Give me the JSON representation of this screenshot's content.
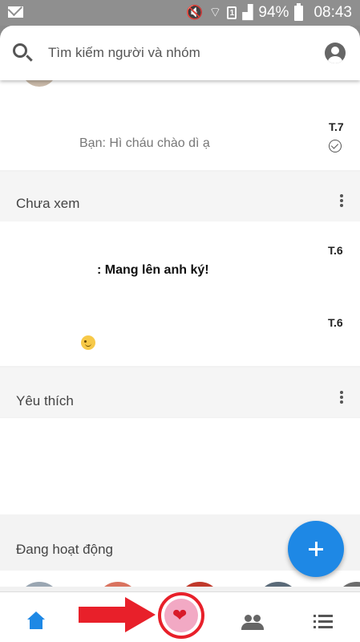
{
  "status_bar": {
    "battery": "94%",
    "time": "08:43",
    "sim_label": "1"
  },
  "search": {
    "placeholder": "Tìm kiếm người và nhóm"
  },
  "conversations_top": [
    {
      "preview": "Bạn: Hì cháu chào dì ạ",
      "timestamp": "T.7",
      "status": "seen"
    }
  ],
  "sections": {
    "unread": {
      "title": "Chưa xem",
      "items": [
        {
          "preview": ": Mang lên anh ký!",
          "timestamp": "T.6"
        },
        {
          "preview": "",
          "timestamp": "T.6",
          "emoji": "wink"
        }
      ]
    },
    "favorites": {
      "title": "Yêu thích",
      "items": []
    },
    "active": {
      "title": "Đang hoạt động"
    }
  },
  "colors": {
    "accent": "#1e88e5",
    "highlight": "#e8202a"
  },
  "icons": {
    "search": "search-icon",
    "profile": "profile-icon",
    "more": "more-vert-icon",
    "fab": "plus-icon",
    "home": "home-icon",
    "favorites": "heart-icon",
    "people": "people-icon",
    "menu": "list-icon"
  },
  "bottom_nav": {
    "active_tab": "home"
  }
}
